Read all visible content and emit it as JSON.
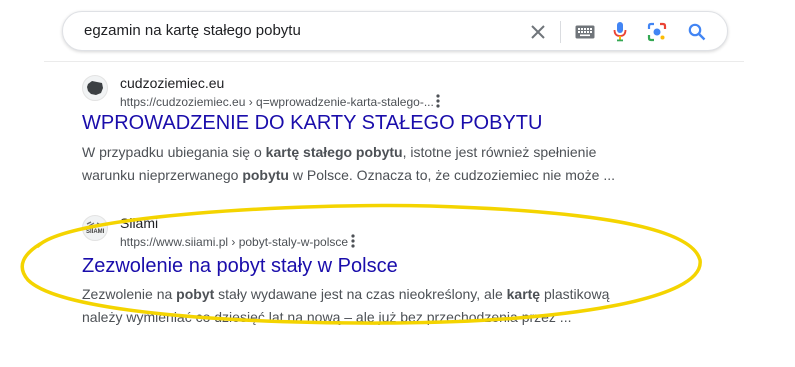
{
  "search": {
    "query": "egzamin na kartę stałego pobytu"
  },
  "results": [
    {
      "site_name": "cudzoziemiec.eu",
      "url": "https://cudzoziemiec.eu › q=wprowadzenie-karta-stalego-...",
      "title": "WPROWADZENIE DO KARTY STAŁEGO POBYTU",
      "snippet_parts": [
        {
          "t": "W przypadku ubiegania się o ",
          "b": false
        },
        {
          "t": "kartę stałego pobytu",
          "b": true
        },
        {
          "t": ", istotne jest również spełnienie warunku nieprzerwanego ",
          "b": false
        },
        {
          "t": "pobytu",
          "b": true
        },
        {
          "t": " w Polsce. Oznacza to, że cudzoziemiec nie może ...",
          "b": false
        }
      ]
    },
    {
      "site_name": "Siiami",
      "url": "https://www.siiami.pl › pobyt-staly-w-polsce",
      "title": "Zezwolenie na pobyt stały w Polsce",
      "snippet_parts": [
        {
          "t": "Zezwolenie na ",
          "b": false
        },
        {
          "t": "pobyt",
          "b": true
        },
        {
          "t": " stały wydawane jest na czas nieokreślony, ale ",
          "b": false
        },
        {
          "t": "kartę",
          "b": true
        },
        {
          "t": " plastikową należy wymieniać co dziesięć lat na nową – ale już bez przechodzenia przez ...",
          "b": false
        }
      ]
    }
  ],
  "icons": [
    "clear-icon",
    "keyboard-icon",
    "microphone-icon",
    "lens-icon",
    "search-icon",
    "more-options-icon"
  ],
  "colors": {
    "title_link": "#1a0dab",
    "highlight": "#f4d400"
  }
}
